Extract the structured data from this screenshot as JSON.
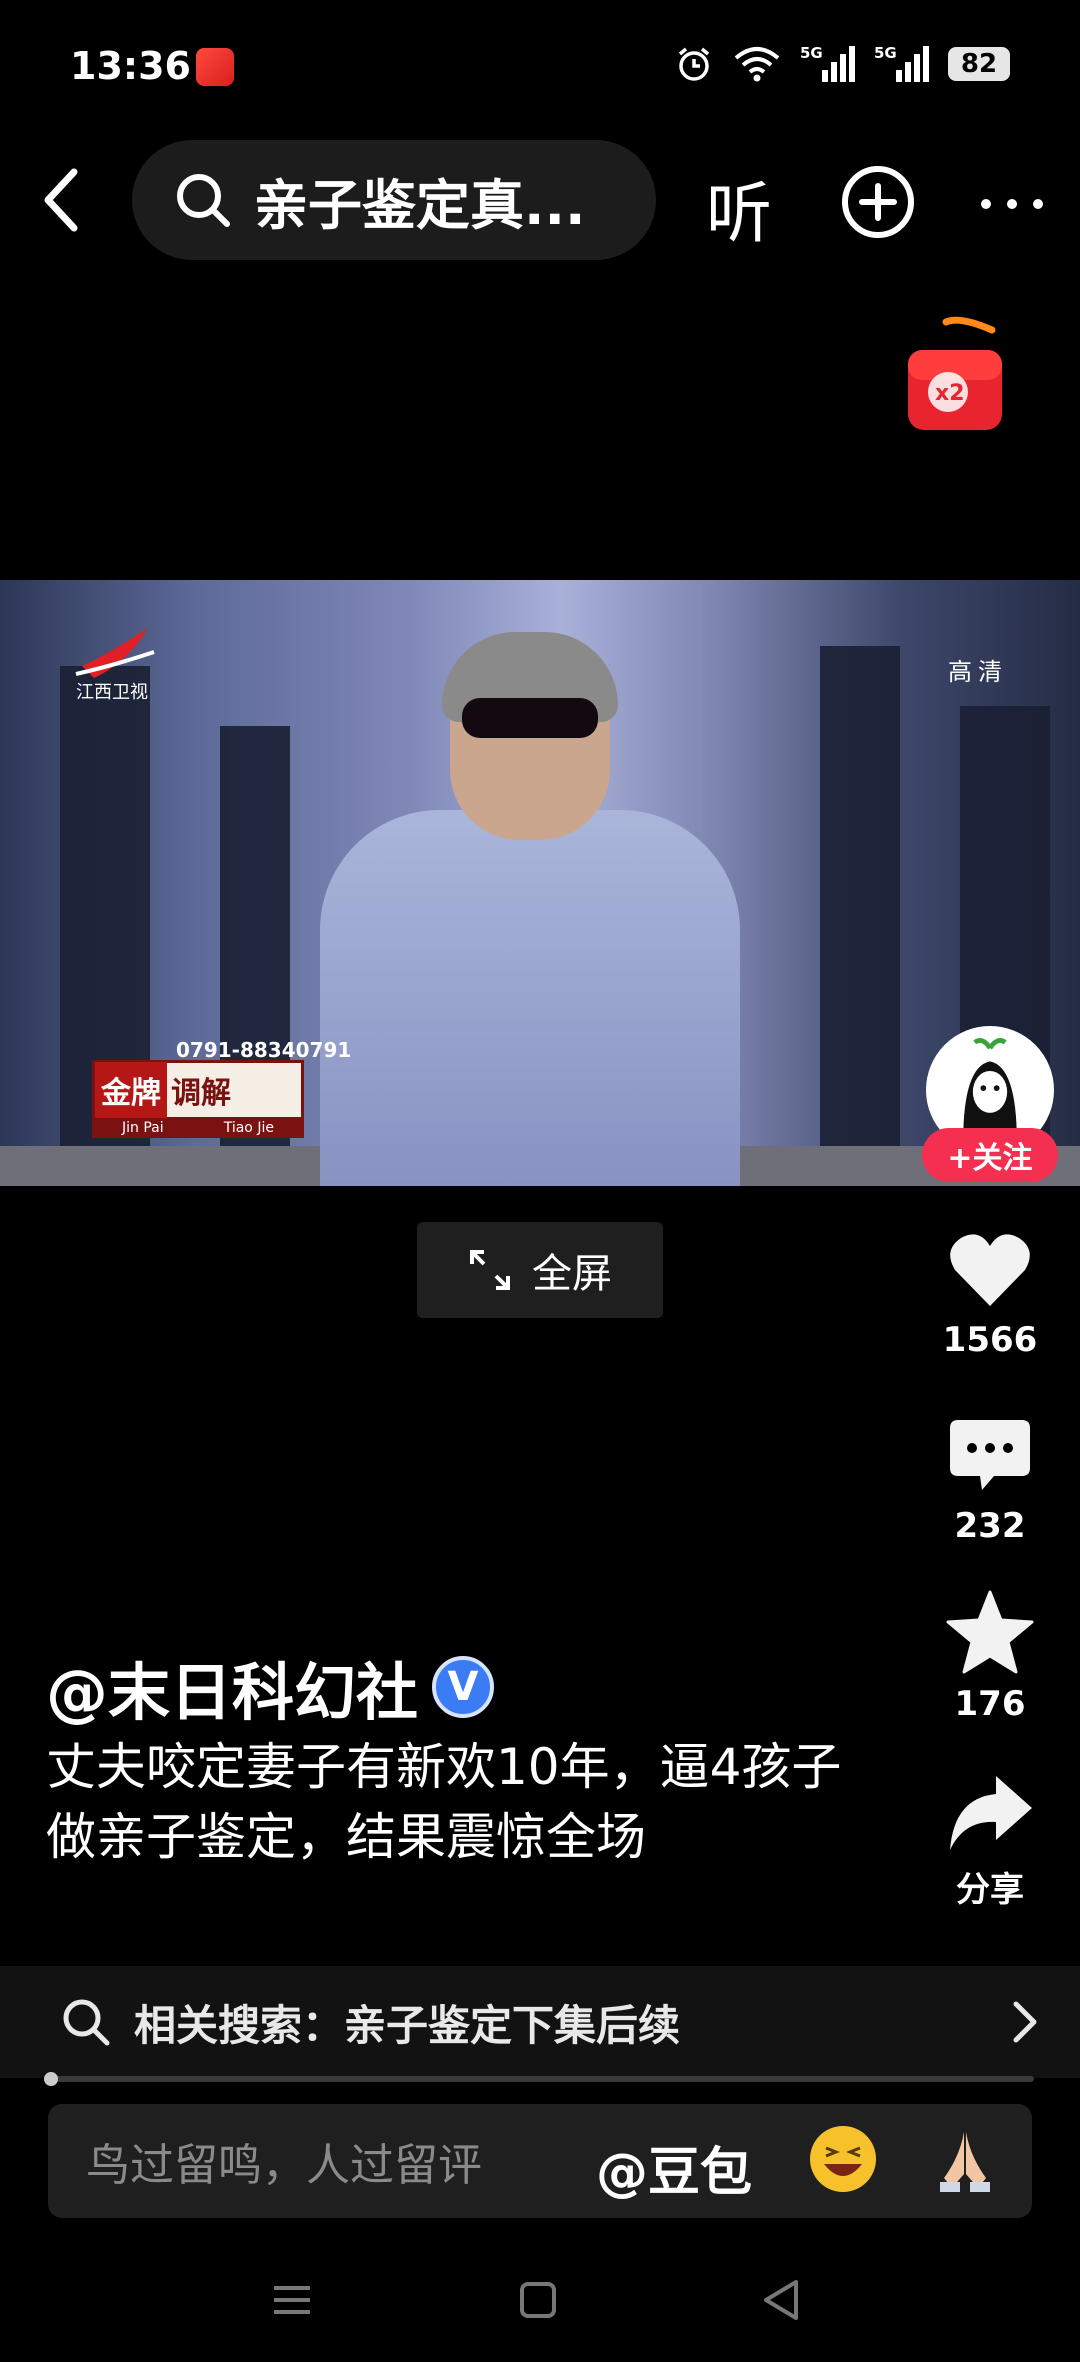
{
  "status_bar": {
    "time": "13:36",
    "battery": "82",
    "signal1": "5G",
    "signal2": "5G"
  },
  "top_nav": {
    "search_text": "亲子鉴定真...",
    "listen_label": "听"
  },
  "video": {
    "station_name": "江西卫视",
    "hd_label": "高清",
    "show_phone": "0791-88340791",
    "show_title_a": "金牌",
    "show_title_b": "调解",
    "show_sub_a": "Jin Pai",
    "show_sub_b": "Tiao Jie"
  },
  "fullscreen": {
    "label": "全屏"
  },
  "right_rail": {
    "follow_label": "+关注",
    "likes": "1566",
    "comments": "232",
    "favorites": "176",
    "share_label": "分享"
  },
  "post": {
    "author": "@末日科幻社",
    "verified_mark": "V",
    "caption": "丈夫咬定妻子有新欢10年，逼4孩子做亲子鉴定，结果震惊全场"
  },
  "related_search": {
    "label": "相关搜索：亲子鉴定下集后续"
  },
  "progress": {
    "value": 0.01
  },
  "comment_bar": {
    "placeholder": "鸟过留鸣，人过留评",
    "mention": "@豆包"
  },
  "colors": {
    "accent_red": "#f52f4f",
    "verified_blue": "#3b7cf5",
    "background": "#000000"
  }
}
